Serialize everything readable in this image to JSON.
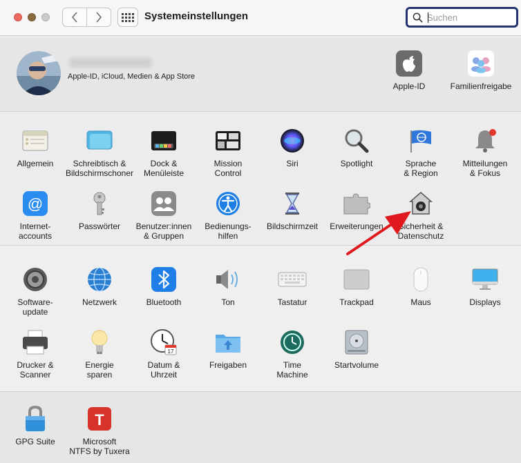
{
  "window": {
    "title": "Systemeinstellungen"
  },
  "search": {
    "placeholder": "Suchen",
    "value": ""
  },
  "apple_id": {
    "subtitle": "Apple-ID, iCloud, Medien & App Store"
  },
  "top_items": [
    {
      "label": "Apple-ID",
      "icon": "apple-id-icon"
    },
    {
      "label": "Familienfreigabe",
      "icon": "family-sharing-icon"
    }
  ],
  "section1": [
    {
      "label": "Allgemein",
      "icon": "general-icon"
    },
    {
      "label": "Schreibtisch &\nBildschirmschoner",
      "icon": "desktop-screensaver-icon"
    },
    {
      "label": "Dock &\nMenüleiste",
      "icon": "dock-menubar-icon"
    },
    {
      "label": "Mission\nControl",
      "icon": "mission-control-icon"
    },
    {
      "label": "Siri",
      "icon": "siri-icon"
    },
    {
      "label": "Spotlight",
      "icon": "spotlight-icon"
    },
    {
      "label": "Sprache\n& Region",
      "icon": "language-region-icon"
    },
    {
      "label": "Mitteilungen\n& Fokus",
      "icon": "notifications-icon"
    },
    {
      "label": "Internet-\naccounts",
      "icon": "internet-accounts-icon"
    },
    {
      "label": "Passwörter",
      "icon": "passwords-icon"
    },
    {
      "label": "Benutzer:innen\n& Gruppen",
      "icon": "users-groups-icon"
    },
    {
      "label": "Bedienungs-\nhilfen",
      "icon": "accessibility-icon"
    },
    {
      "label": "Bildschirmzeit",
      "icon": "screen-time-icon"
    },
    {
      "label": "Erweiterungen",
      "icon": "extensions-icon"
    },
    {
      "label": "Sicherheit &\nDatenschutz",
      "icon": "security-privacy-icon"
    }
  ],
  "section2": [
    {
      "label": "Software-\nupdate",
      "icon": "software-update-icon"
    },
    {
      "label": "Netzwerk",
      "icon": "network-icon"
    },
    {
      "label": "Bluetooth",
      "icon": "bluetooth-icon"
    },
    {
      "label": "Ton",
      "icon": "sound-icon"
    },
    {
      "label": "Tastatur",
      "icon": "keyboard-icon"
    },
    {
      "label": "Trackpad",
      "icon": "trackpad-icon"
    },
    {
      "label": "Maus",
      "icon": "mouse-icon"
    },
    {
      "label": "Displays",
      "icon": "displays-icon"
    },
    {
      "label": "Drucker &\nScanner",
      "icon": "printers-scanners-icon"
    },
    {
      "label": "Energie\nsparen",
      "icon": "energy-saver-icon"
    },
    {
      "label": "Datum &\nUhrzeit",
      "icon": "date-time-icon"
    },
    {
      "label": "Freigaben",
      "icon": "sharing-icon"
    },
    {
      "label": "Time\nMachine",
      "icon": "time-machine-icon"
    },
    {
      "label": "Startvolume",
      "icon": "startup-disk-icon"
    }
  ],
  "section3": [
    {
      "label": "GPG Suite",
      "icon": "gpg-suite-icon"
    },
    {
      "label": "Microsoft\nNTFS by Tuxera",
      "icon": "tuxera-ntfs-icon"
    }
  ],
  "calendar": {
    "day": "17"
  },
  "colors": {
    "accent": "#22336e",
    "arrow": "#e0191f"
  }
}
